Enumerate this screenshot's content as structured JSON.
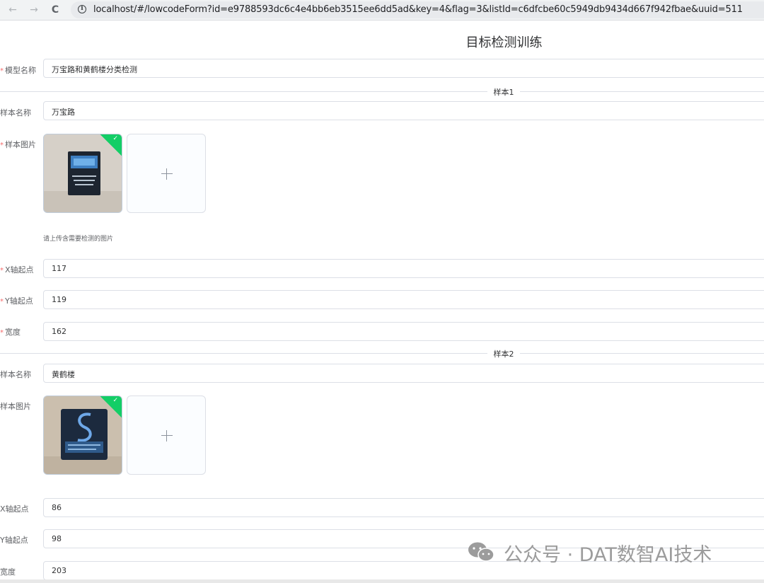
{
  "browser": {
    "back_label": "←",
    "forward_label": "→",
    "reload_label": "C",
    "info_label": "i",
    "url": "localhost/#/lowcodeForm?id=e9788593dc6c4e4bb6eb3515ee6dd5ad&key=4&flag=3&listId=c6dfcbe60c5949db9434d667f942fbae&uuid=511"
  },
  "form": {
    "title": "目标检测训练",
    "model_name_label": "模型名称",
    "model_name_value": "万宝路和黄鹤楼分类检测",
    "required_mark": "*",
    "upload_tip": "请上传含需要检测的图片",
    "samples": [
      {
        "divider": "样本1",
        "name_label": "样本名称",
        "name_value": "万宝路",
        "image_label": "样本图片",
        "x_label": "X轴起点",
        "x_value": "117",
        "y_label": "Y轴起点",
        "y_value": "119",
        "width_label": "宽度",
        "width_value": "162"
      },
      {
        "divider": "样本2",
        "name_label": "样本名称",
        "name_value": "黄鹤楼",
        "image_label": "样本图片",
        "x_label": "X轴起点",
        "x_value": "86",
        "y_label": "Y轴起点",
        "y_value": "98",
        "width_label": "宽度",
        "width_value": "203"
      }
    ]
  },
  "watermark": {
    "text": "公众号 · DAT数智AI技术"
  },
  "colors": {
    "required": "#f56c6c",
    "success_badge": "#13ce66",
    "border": "#dcdfe6"
  }
}
